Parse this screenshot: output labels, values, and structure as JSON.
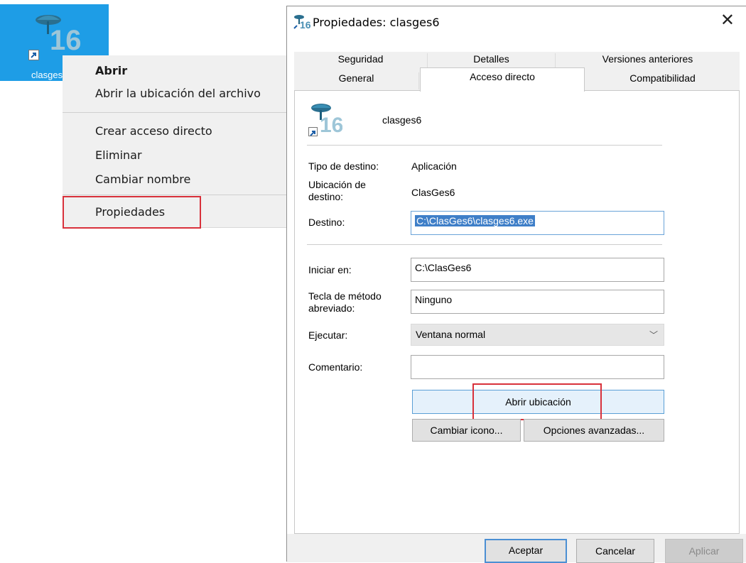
{
  "desktop": {
    "icon_label": "clasges6"
  },
  "context_menu": {
    "items": [
      {
        "label": "Abrir",
        "bold": true
      },
      {
        "label": "Abrir la ubicación del archivo"
      },
      {
        "label": "Crear acceso directo"
      },
      {
        "label": "Eliminar"
      },
      {
        "label": "Cambiar nombre"
      },
      {
        "label": "Propiedades"
      }
    ]
  },
  "dialog": {
    "title": "Propiedades: clasges6",
    "close_glyph": "✕",
    "tabs_row1": [
      "Seguridad",
      "Detalles",
      "Versiones anteriores"
    ],
    "tabs_row2": [
      "General",
      "Acceso directo",
      "Compatibilidad"
    ],
    "active_tab": "Acceso directo",
    "app_name": "clasges6",
    "fields": {
      "target_type_label": "Tipo de destino:",
      "target_type_value": "Aplicación",
      "target_location_label": "Ubicación de destino:",
      "target_location_value": "ClasGes6",
      "target_label": "Destino:",
      "target_value": "C:\\ClasGes6\\clasges6.exe",
      "start_in_label": "Iniciar en:",
      "start_in_value": "C:\\ClasGes6",
      "shortcut_key_label": "Tecla de método abreviado:",
      "shortcut_key_value": "Ninguno",
      "run_label": "Ejecutar:",
      "run_value": "Ventana normal",
      "comment_label": "Comentario:",
      "comment_value": ""
    },
    "buttons": {
      "open_location": "Abrir ubicación",
      "change_icon": "Cambiar icono...",
      "advanced": "Opciones avanzadas...",
      "ok": "Aceptar",
      "cancel": "Cancelar",
      "apply": "Aplicar"
    }
  },
  "colors": {
    "highlight_box": "#d8313b",
    "desktop_selection": "#1e9de6",
    "text_selection": "#3f7fc8"
  },
  "icons": {
    "app": "banker-lamp-16-icon",
    "shortcut_overlay": "shortcut-arrow-icon",
    "close": "close-icon",
    "dropdown": "chevron-down-icon"
  }
}
